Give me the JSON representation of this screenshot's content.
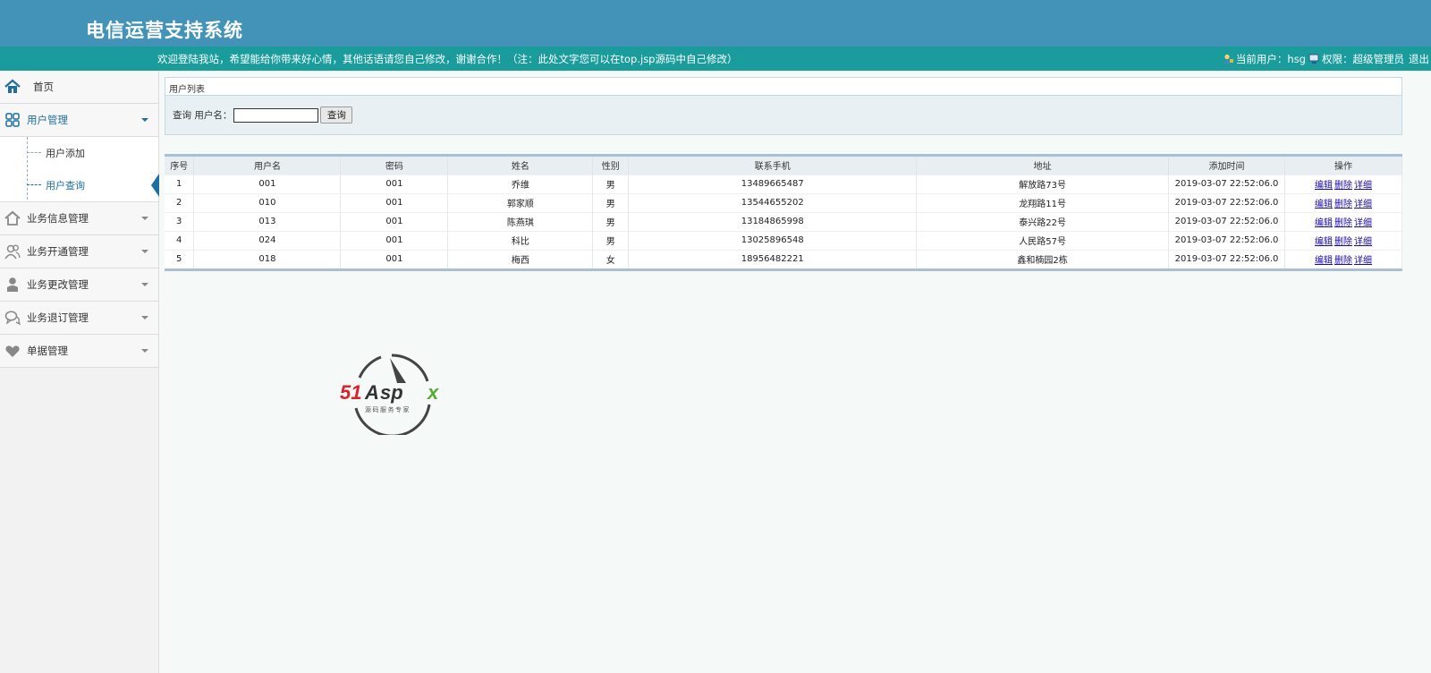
{
  "header": {
    "title": "电信运营支持系统",
    "welcome": "欢迎登陆我站，希望能给你带来好心情，其他话语请您自己修改，谢谢合作！（注：此处文字您可以在top.jsp源码中自己修改）",
    "current_user_label": "当前用户：hsg",
    "role_label": "权限：超级管理员",
    "logout": "退出"
  },
  "sidebar": {
    "home": "首页",
    "user_mgmt": "用户管理",
    "user_add": "用户添加",
    "user_query": "用户查询",
    "biz_info": "业务信息管理",
    "biz_open": "业务开通管理",
    "biz_change": "业务更改管理",
    "biz_cancel": "业务退订管理",
    "bill_mgmt": "单据管理"
  },
  "main": {
    "panel_title": "用户列表",
    "search_label": "查询 用户名：",
    "search_value": "",
    "search_button": "查询",
    "columns": [
      "序号",
      "用户名",
      "密码",
      "姓名",
      "性别",
      "联系手机",
      "地址",
      "添加时间",
      "操作"
    ],
    "rows": [
      {
        "no": "1",
        "username": "001",
        "password": "001",
        "name": "乔维",
        "gender": "男",
        "phone": "13489665487",
        "address": "解放路73号",
        "time": "2019-03-07 22:52:06.0"
      },
      {
        "no": "2",
        "username": "010",
        "password": "001",
        "name": "郭家顺",
        "gender": "男",
        "phone": "13544655202",
        "address": "龙翔路11号",
        "time": "2019-03-07 22:52:06.0"
      },
      {
        "no": "3",
        "username": "013",
        "password": "001",
        "name": "陈燕琪",
        "gender": "男",
        "phone": "13184865998",
        "address": "泰兴路22号",
        "time": "2019-03-07 22:52:06.0"
      },
      {
        "no": "4",
        "username": "024",
        "password": "001",
        "name": "科比",
        "gender": "男",
        "phone": "13025896548",
        "address": "人民路57号",
        "time": "2019-03-07 22:52:06.0"
      },
      {
        "no": "5",
        "username": "018",
        "password": "001",
        "name": "梅西",
        "gender": "女",
        "phone": "18956482221",
        "address": "鑫和楠园2栋",
        "time": "2019-03-07 22:52:06.0"
      }
    ],
    "ops": {
      "edit": "编辑",
      "delete": "删除",
      "detail": "详细"
    }
  },
  "watermark": {
    "brand": "51Aspx",
    "tagline": "源码服务专家"
  },
  "colors": {
    "header": "#4393b9",
    "subbar": "#1a9b9c",
    "accent": "#1f6f9e"
  }
}
